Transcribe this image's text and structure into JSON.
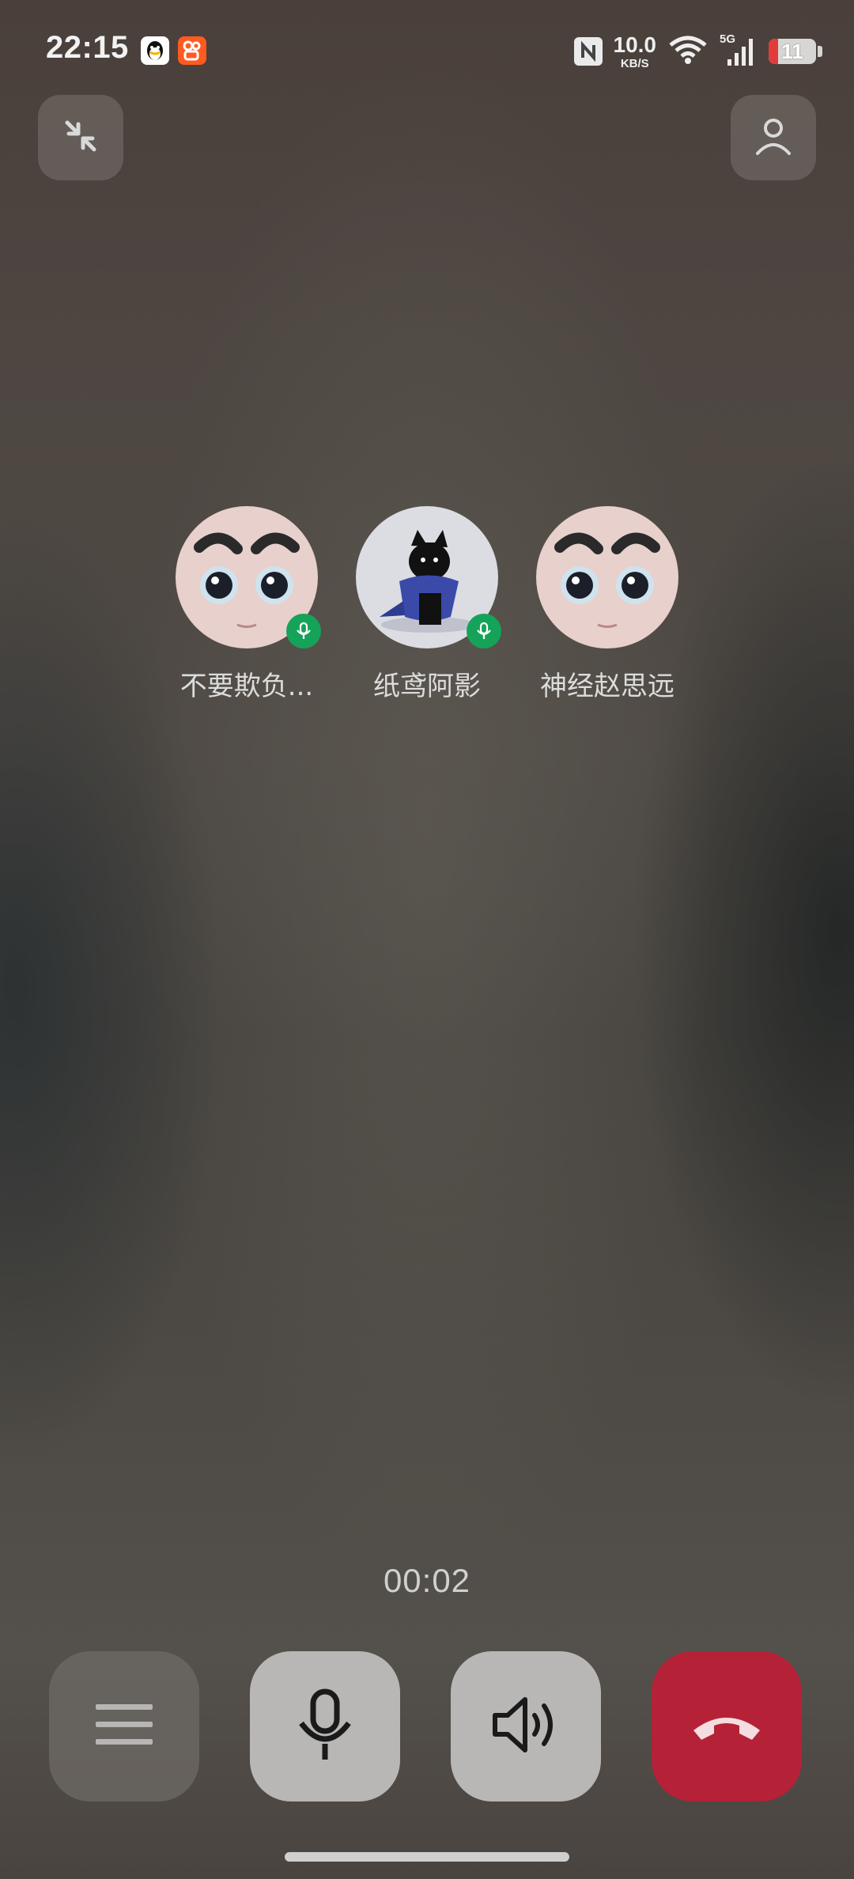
{
  "status_bar": {
    "time": "22:15",
    "notification_icons": [
      "qq-icon",
      "kuaishou-icon"
    ],
    "net_speed_value": "10.0",
    "net_speed_unit": "KB/S",
    "network_type": "5G",
    "battery_level": "11",
    "battery_color": "#e23b3b"
  },
  "top_controls": {
    "minimize_icon": "minimize-arrows-icon",
    "add_member_icon": "person-icon"
  },
  "participants": [
    {
      "name": "不要欺负...",
      "avatar": "cartoon-face",
      "mic_active": true
    },
    {
      "name": "纸鸢阿影",
      "avatar": "black-cat-scarf",
      "mic_active": true
    },
    {
      "name": "神经赵思远",
      "avatar": "cartoon-face",
      "mic_active": false
    }
  ],
  "call": {
    "duration": "00:02"
  },
  "bottom_controls": [
    {
      "name": "menu",
      "icon": "menu-lines-icon"
    },
    {
      "name": "microphone",
      "icon": "microphone-icon"
    },
    {
      "name": "speaker",
      "icon": "speaker-icon"
    },
    {
      "name": "hang-up",
      "icon": "hang-up-icon",
      "color": "#b52238"
    }
  ],
  "colors": {
    "mic_badge": "#15a35a",
    "hang_up": "#b52238"
  }
}
